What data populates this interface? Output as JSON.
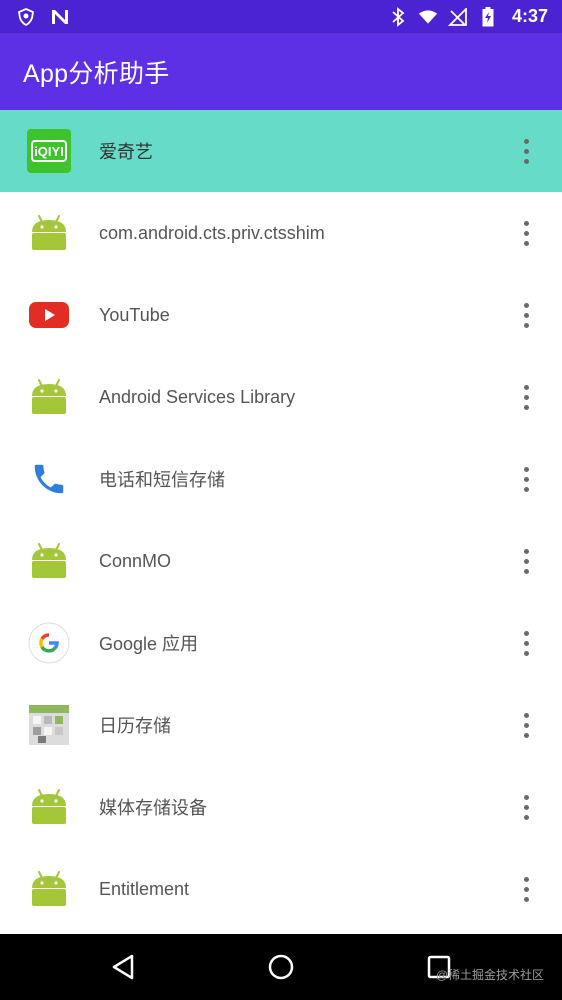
{
  "status_bar": {
    "time": "4:37",
    "left_icons": [
      "shield-notification-icon",
      "n-notification-icon"
    ],
    "right_icons": [
      "bluetooth-icon",
      "wifi-icon",
      "no-signal-icon",
      "battery-charging-icon"
    ]
  },
  "app_bar": {
    "title": "App分析助手",
    "color": "#5e30e5"
  },
  "apps": [
    {
      "label": "爱奇艺",
      "icon": "iqiyi-icon",
      "selected": true
    },
    {
      "label": "com.android.cts.priv.ctsshim",
      "icon": "android-icon"
    },
    {
      "label": "YouTube",
      "icon": "youtube-icon"
    },
    {
      "label": "Android Services Library",
      "icon": "android-icon"
    },
    {
      "label": "电话和短信存储",
      "icon": "phone-icon"
    },
    {
      "label": "ConnMO",
      "icon": "android-icon"
    },
    {
      "label": "Google 应用",
      "icon": "google-icon"
    },
    {
      "label": "日历存储",
      "icon": "calendar-storage-icon"
    },
    {
      "label": "媒体存储设备",
      "icon": "android-icon"
    },
    {
      "label": "Entitlement",
      "icon": "android-icon"
    }
  ],
  "nav_bar": {
    "buttons": [
      "back-icon",
      "home-icon",
      "recents-icon"
    ],
    "watermark": "@稀土掘金技术社区"
  },
  "colors": {
    "status_bar": "#4c23d2",
    "selected_row": "#66dbc8",
    "android_green": "#a4c639"
  }
}
